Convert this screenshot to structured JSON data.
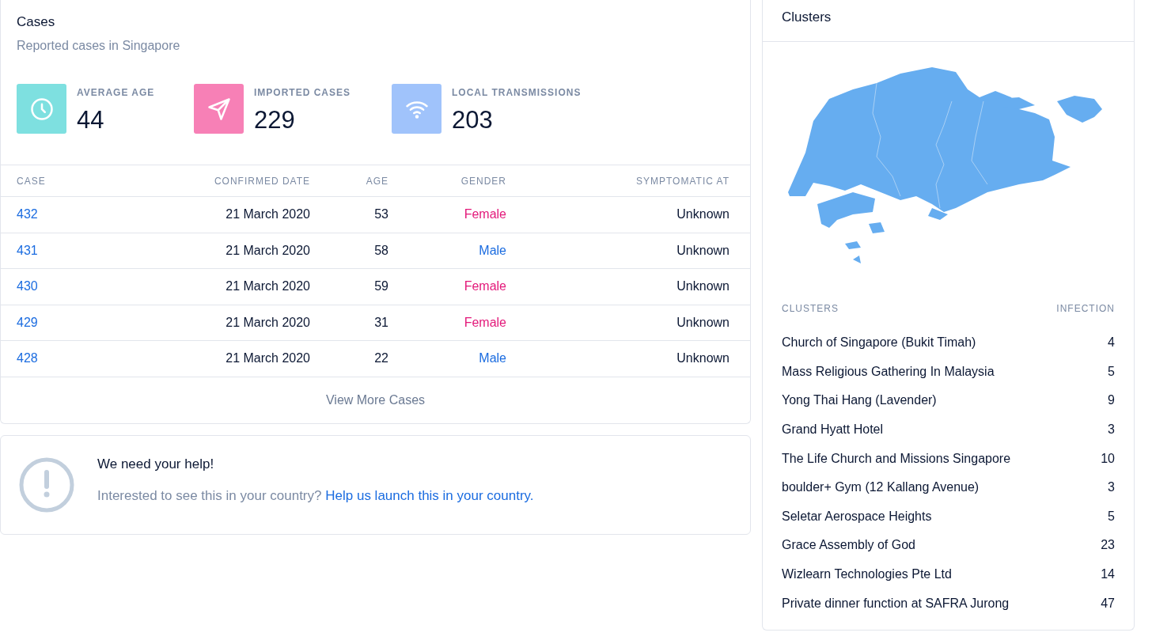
{
  "cases": {
    "title": "Cases",
    "subtitle": "Reported cases in Singapore",
    "stats": [
      {
        "kind": "clock",
        "label": "AVERAGE AGE",
        "value": "44",
        "color": "#7ee0e0"
      },
      {
        "kind": "send",
        "label": "IMPORTED CASES",
        "value": "229",
        "color": "#f780b6"
      },
      {
        "kind": "wifi",
        "label": "LOCAL TRANSMISSIONS",
        "value": "203",
        "color": "#a0c3fb"
      }
    ],
    "table": {
      "columns": [
        "CASE",
        "CONFIRMED DATE",
        "AGE",
        "GENDER",
        "SYMPTOMATIC AT"
      ],
      "rows": [
        {
          "case": "432",
          "confirmed_date": "21 March 2020",
          "age": "53",
          "gender": "Female",
          "color": "#e3197a",
          "symptomatic_at": "Unknown"
        },
        {
          "case": "431",
          "confirmed_date": "21 March 2020",
          "age": "58",
          "gender": "Male",
          "color": "#1b6ce0",
          "symptomatic_at": "Unknown"
        },
        {
          "case": "430",
          "confirmed_date": "21 March 2020",
          "age": "59",
          "gender": "Female",
          "color": "#e3197a",
          "symptomatic_at": "Unknown"
        },
        {
          "case": "429",
          "confirmed_date": "21 March 2020",
          "age": "31",
          "gender": "Female",
          "color": "#e3197a",
          "symptomatic_at": "Unknown"
        },
        {
          "case": "428",
          "confirmed_date": "21 March 2020",
          "age": "22",
          "gender": "Male",
          "color": "#1b6ce0",
          "symptomatic_at": "Unknown"
        }
      ]
    },
    "view_more": "View More Cases"
  },
  "help": {
    "title": "We need your help!",
    "text": "Interested to see this in your country?",
    "link": "Help us launch this in your country."
  },
  "clusters": {
    "title": "Clusters",
    "columns": [
      "CLUSTERS",
      "INFECTION"
    ],
    "rows": [
      {
        "name": "Church of Singapore (Bukit Timah)",
        "infection": "4"
      },
      {
        "name": "Mass Religious Gathering In Malaysia",
        "infection": "5"
      },
      {
        "name": "Yong Thai Hang (Lavender)",
        "infection": "9"
      },
      {
        "name": "Grand Hyatt Hotel",
        "infection": "3"
      },
      {
        "name": "The Life Church and Missions Singapore",
        "infection": "10"
      },
      {
        "name": "boulder+ Gym (12 Kallang Avenue)",
        "infection": "3"
      },
      {
        "name": "Seletar Aerospace Heights",
        "infection": "5"
      },
      {
        "name": "Grace Assembly of God",
        "infection": "23"
      },
      {
        "name": "Wizlearn Technologies Pte Ltd",
        "infection": "14"
      },
      {
        "name": "Private dinner function at SAFRA Jurong",
        "infection": "47"
      }
    ]
  }
}
